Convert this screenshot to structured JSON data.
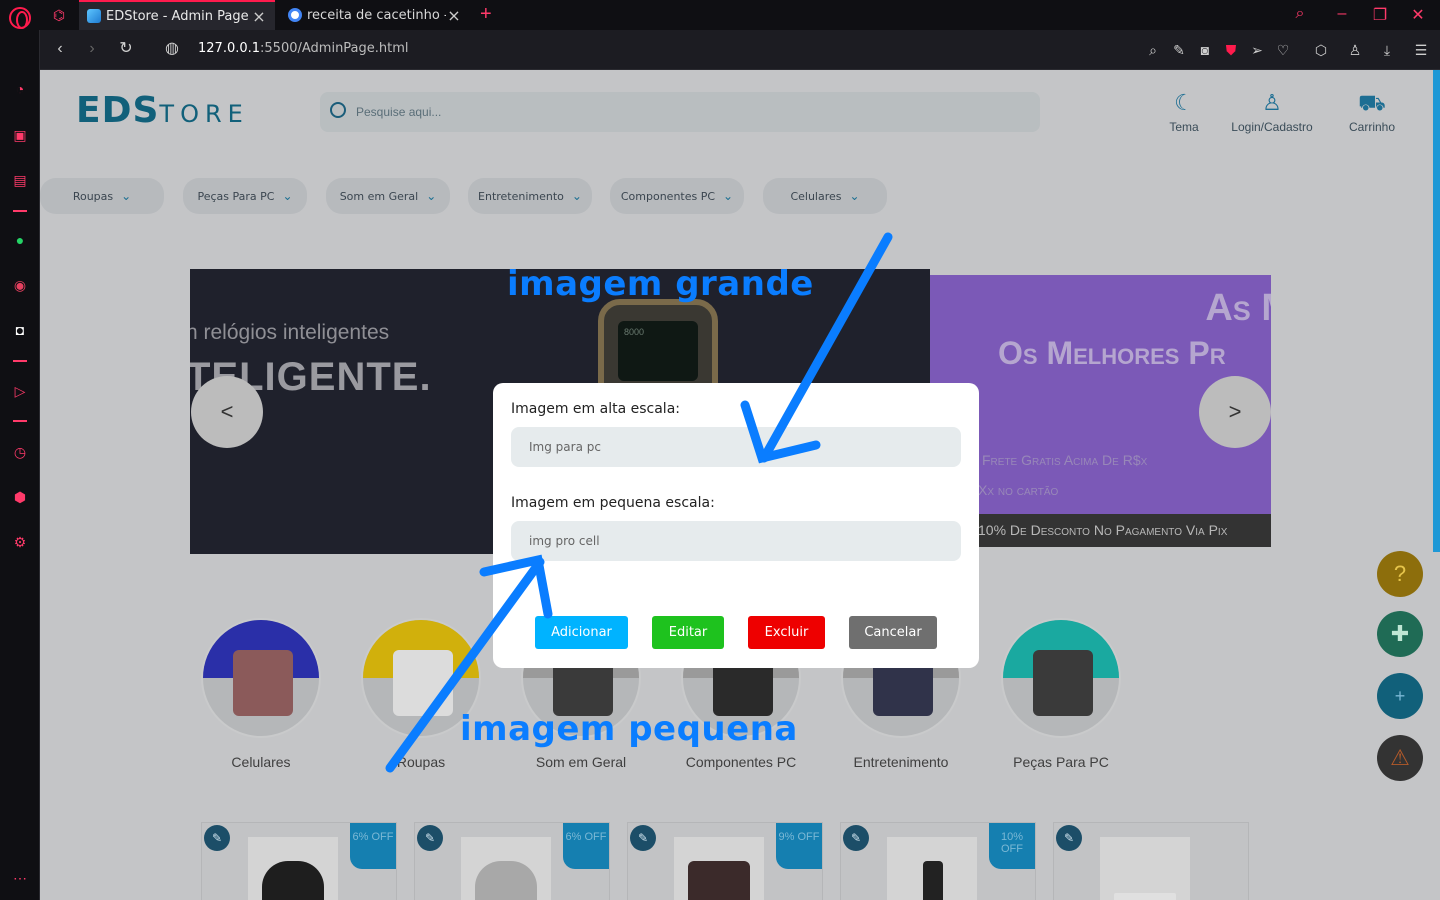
{
  "browser": {
    "tabs": [
      {
        "title": "EDStore - Admin Page",
        "active": true
      },
      {
        "title": "receita de cacetinho - Pesq",
        "active": false
      }
    ],
    "url_host": "127.0.0.1",
    "url_rest": ":5500/AdminPage.html"
  },
  "site": {
    "logo_big": "EDS",
    "logo_small": "TORE",
    "search_placeholder": "Pesquise aqui...",
    "header_actions": [
      {
        "label": "Tema",
        "icon": "moon-icon"
      },
      {
        "label": "Login/Cadastro",
        "icon": "user-icon"
      },
      {
        "label": "Carrinho",
        "icon": "cart-icon"
      }
    ],
    "categories_nav": [
      "Roupas",
      "Peças Para PC",
      "Som em Geral",
      "Entretenimento",
      "Componentes PC",
      "Celulares"
    ],
    "banner_left": {
      "line1": "n relógios inteligentes",
      "line2": "TELIGENTE.",
      "watch_text": "8000"
    },
    "banner_right": {
      "line1": "As Me",
      "line2": "Os Melhores Pr",
      "line3": "Frete Gratis Acima De R$x",
      "line4": "Xx no cartão",
      "strip": "10% De Desconto No Pagamento Via Pix"
    },
    "carousel_prev": "<",
    "carousel_next": ">",
    "category_circles": [
      {
        "label": "Celulares",
        "drip_color": "#2a2fa8"
      },
      {
        "label": "Roupas",
        "drip_color": "#d1b00c"
      },
      {
        "label": "Som em Geral",
        "drip_color": "#8a8a8a"
      },
      {
        "label": "Componentes PC",
        "drip_color": "#8a8a8a"
      },
      {
        "label": "Entretenimento",
        "drip_color": "#8a8a8a"
      },
      {
        "label": "Peças Para PC",
        "drip_color": "#1aa9a0"
      }
    ],
    "products": [
      {
        "badge": "6% OFF"
      },
      {
        "badge": "6% OFF"
      },
      {
        "badge": "9% OFF"
      },
      {
        "badge": "10% OFF"
      },
      {
        "badge": ""
      }
    ]
  },
  "modal": {
    "label_high": "Imagem em alta escala:",
    "placeholder_high": "Img para pc",
    "label_low": "Imagem em pequena escala:",
    "placeholder_low": "img pro cell",
    "btn_add": "Adicionar",
    "btn_edit": "Editar",
    "btn_delete": "Excluir",
    "btn_cancel": "Cancelar",
    "colors": {
      "add": "#00b3ff",
      "edit": "#1ec21e",
      "delete": "#ee0000",
      "cancel": "#6f6f6f"
    }
  },
  "annotations": {
    "big": "imagem grande",
    "small": "imagem pequena",
    "color": "#0a7dff"
  }
}
